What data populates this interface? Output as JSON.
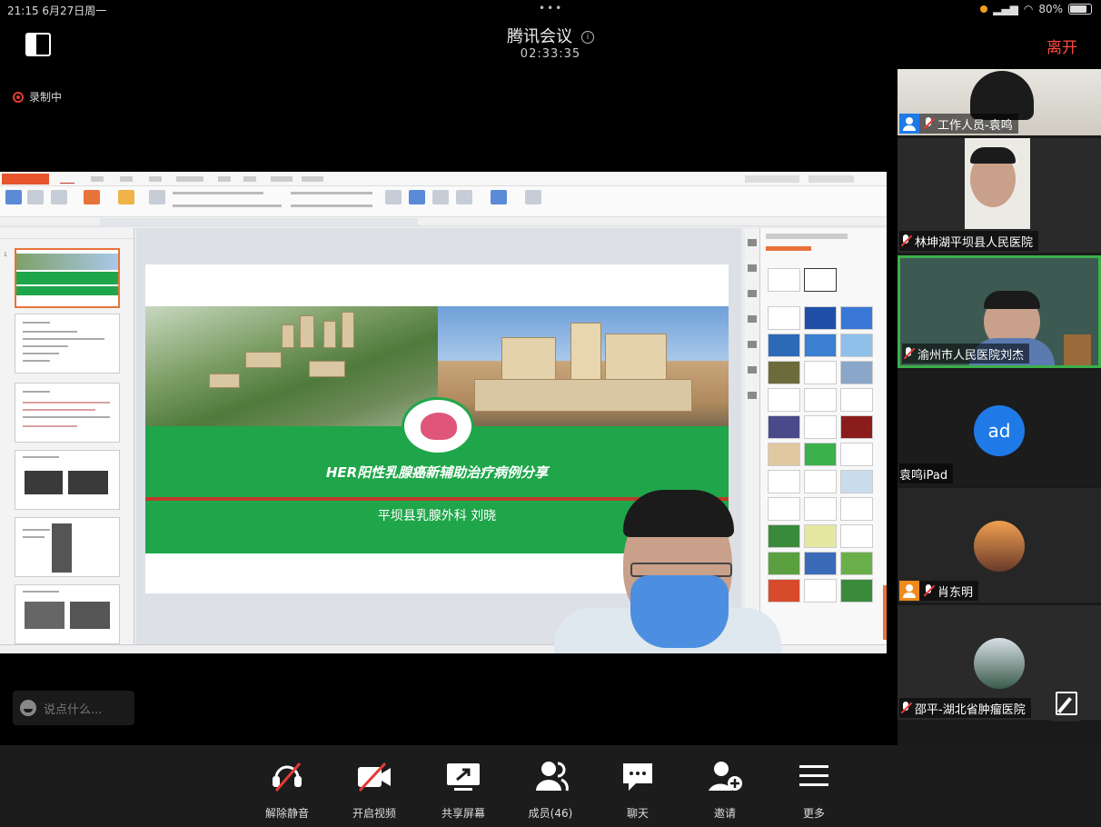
{
  "status_bar": {
    "time": "21:15 6月27日周一",
    "battery": "80%",
    "indicator_color": "#f0a020"
  },
  "header": {
    "title": "腾讯会议",
    "timer": "02:33:35",
    "leave_label": "离开",
    "leave_color": "#ff4b3e"
  },
  "recording": {
    "label": "录制中"
  },
  "shared_slide": {
    "title": "HER阳性乳腺癌新辅助治疗病例分享",
    "subtitle": "平坝县乳腺外科 刘晓"
  },
  "chat": {
    "placeholder": "说点什么..."
  },
  "participants": [
    {
      "name": "工作人员-袁鸣",
      "badge": "user-icon",
      "badge_color": "#1f7ae8",
      "muted": true
    },
    {
      "name": "林坤湖平坝县人民医院",
      "muted": true
    },
    {
      "name": "渝州市人民医院刘杰",
      "active_speaker": true
    },
    {
      "name": "袁鸣iPad",
      "avatar_text": "ad",
      "avatar_color": "#1f7ae8"
    },
    {
      "name": "肖东明",
      "badge": "user-icon",
      "badge_color": "#f08a1c",
      "muted": true
    },
    {
      "name": "邵平-湖北省肿瘤医院",
      "muted": true
    }
  ],
  "toolbar": {
    "items": [
      {
        "label": "解除静音",
        "icon": "mic-muted-icon"
      },
      {
        "label": "开启视频",
        "icon": "camera-off-icon"
      },
      {
        "label": "共享屏幕",
        "icon": "screen-share-icon"
      },
      {
        "label": "成员(46)",
        "icon": "members-icon"
      },
      {
        "label": "聊天",
        "icon": "chat-icon"
      },
      {
        "label": "邀请",
        "icon": "invite-icon"
      },
      {
        "label": "更多",
        "icon": "more-icon"
      }
    ]
  },
  "colors": {
    "active_border": "#3cb04a",
    "slide_green": "#1fa64a",
    "accent_red": "#c0392b"
  }
}
